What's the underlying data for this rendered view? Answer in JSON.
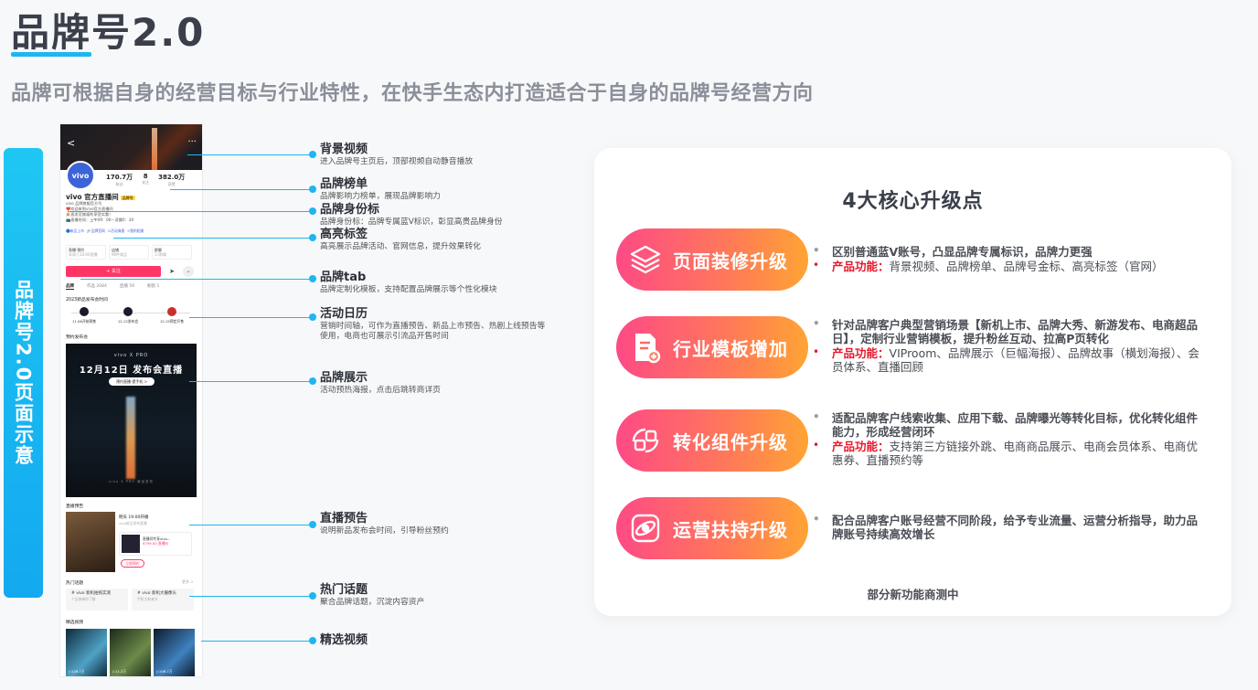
{
  "header": {
    "title": "品牌号2.0",
    "subtitle": "品牌可根据自身的经营目标与行业特性，在快手生态内打造适合于自身的品牌号经营方向"
  },
  "side_label": "品牌号2.0页面示意",
  "phone": {
    "avatar_text": "vivo",
    "stats": [
      {
        "value": "170.7万",
        "label": "粉丝"
      },
      {
        "value": "8",
        "label": "关注"
      },
      {
        "value": "382.0万",
        "label": "获赞"
      }
    ],
    "name": "vivo 官方直播间",
    "badge": "品牌号",
    "lines": [
      "vivo 品牌旗舰官方号",
      "❤️欢迎来到vivo官方直播间",
      "🎉直发官旗福利享受实惠！",
      "📺直播时间：上午09：00—凌晨0：30"
    ],
    "tags": [
      "🔵新品上市",
      "🔗品牌官网",
      "⊙活动海报",
      "⟐我的相册"
    ],
    "cards": [
      {
        "title": "直播·预约",
        "sub": "本周六10:00直播"
      },
      {
        "title": "店铺",
        "sub": "98件商品"
      },
      {
        "title": "群聊",
        "sub": "17群聊"
      }
    ],
    "follow": "+ 关注",
    "tabs": [
      "品牌",
      "作品 2084",
      "直播 59",
      "橱窗 1"
    ],
    "calendar_title": "2023新品发布会时间",
    "calendar": [
      {
        "label": "11.06开始预售"
      },
      {
        "label": "12.12发布会"
      },
      {
        "label": "12.15预定开售"
      }
    ],
    "preview_title": "预约发布会",
    "poster": {
      "brand": "vivo X PRO",
      "headline": "12月12日 发布会直播",
      "button": "预约直播·提手机 >",
      "footer": "vivo X PRO 新品发布"
    },
    "live_title": "直播预告",
    "live_text": "明天 19:00开播",
    "live_sub": "vivo新品发布直播",
    "live_product": "直播间专享vivo...",
    "live_price": "¥799.00 直播价",
    "live_button": "立即预约",
    "topic_title": "热门话题",
    "topic_more": "更多 >",
    "topics": [
      {
        "title": "# vivo 新机拍照实测",
        "sub": "个全体带你了解"
      },
      {
        "title": "# vivo 新机大摄像头",
        "sub": "手机大有来头"
      }
    ],
    "video_title": "精选视频",
    "videos": [
      "▷126.7万",
      "▷11.2万",
      "▷106.7万"
    ]
  },
  "annotations": [
    {
      "title": "背景视频",
      "desc": "进入品牌号主页后，顶部视频自动静音播放"
    },
    {
      "title": "品牌榜单",
      "desc": "品牌影响力榜单，展现品牌影响力"
    },
    {
      "title": "品牌身份标",
      "desc": "品牌身份标：品牌专属蓝V标识，彰显高贵品牌身份"
    },
    {
      "title": "高亮标签",
      "desc": "高亮展示品牌活动、官网信息，提升效果转化"
    },
    {
      "title": "品牌tab",
      "desc": "品牌定制化模板，支持配置品牌展示等个性化模块"
    },
    {
      "title": "活动日历",
      "desc": "营销时间轴，可作为直播预告、新品上市预告、热剧上线预告等使用，电商也可展示引流品开售时间"
    },
    {
      "title": "品牌展示",
      "desc": "活动预热海报，点击后跳转商详页"
    },
    {
      "title": "直播预告",
      "desc": "说明新品发布会时间，引导粉丝预约"
    },
    {
      "title": "热门话题",
      "desc": "聚合品牌话题，沉淀内容资产"
    },
    {
      "title": "精选视频",
      "desc": ""
    }
  ],
  "card": {
    "title": "4大核心升级点",
    "footer": "部分新功能商测中",
    "key_label": "产品功能：",
    "items": [
      {
        "icon": "layers-icon",
        "label": "页面装修升级",
        "bullets": [
          "区别普通蓝V账号，凸显品牌专属标识，品牌力更强"
        ],
        "product": "背景视频、品牌榜单、品牌号金标、高亮标签（官网）"
      },
      {
        "icon": "document-add-icon",
        "label": "行业模板增加",
        "bullets": [
          "针对品牌客户典型营销场景【新机上市、品牌大秀、新游发布、电商超品日】，定制行业营销模板，提升粉丝互动、拉高P页转化"
        ],
        "product": "VIProom、品牌展示（巨幅海报）、品牌故事（横划海报）、会员体系、直播回顾"
      },
      {
        "icon": "swap-icon",
        "label": "转化组件升级",
        "bullets": [
          "适配品牌客户线索收集、应用下载、品牌曝光等转化目标，优化转化组件能力，形成经营闭环"
        ],
        "product": "支持第三方链接外跳、电商商品展示、电商会员体系、电商优惠券、直播预约等"
      },
      {
        "icon": "orbit-icon",
        "label": "运营扶持升级",
        "bullets": [
          "配合品牌客户账号经营不同阶段，给予专业流量、运营分析指导，助力品牌账号持续高效增长"
        ],
        "product": ""
      }
    ]
  }
}
